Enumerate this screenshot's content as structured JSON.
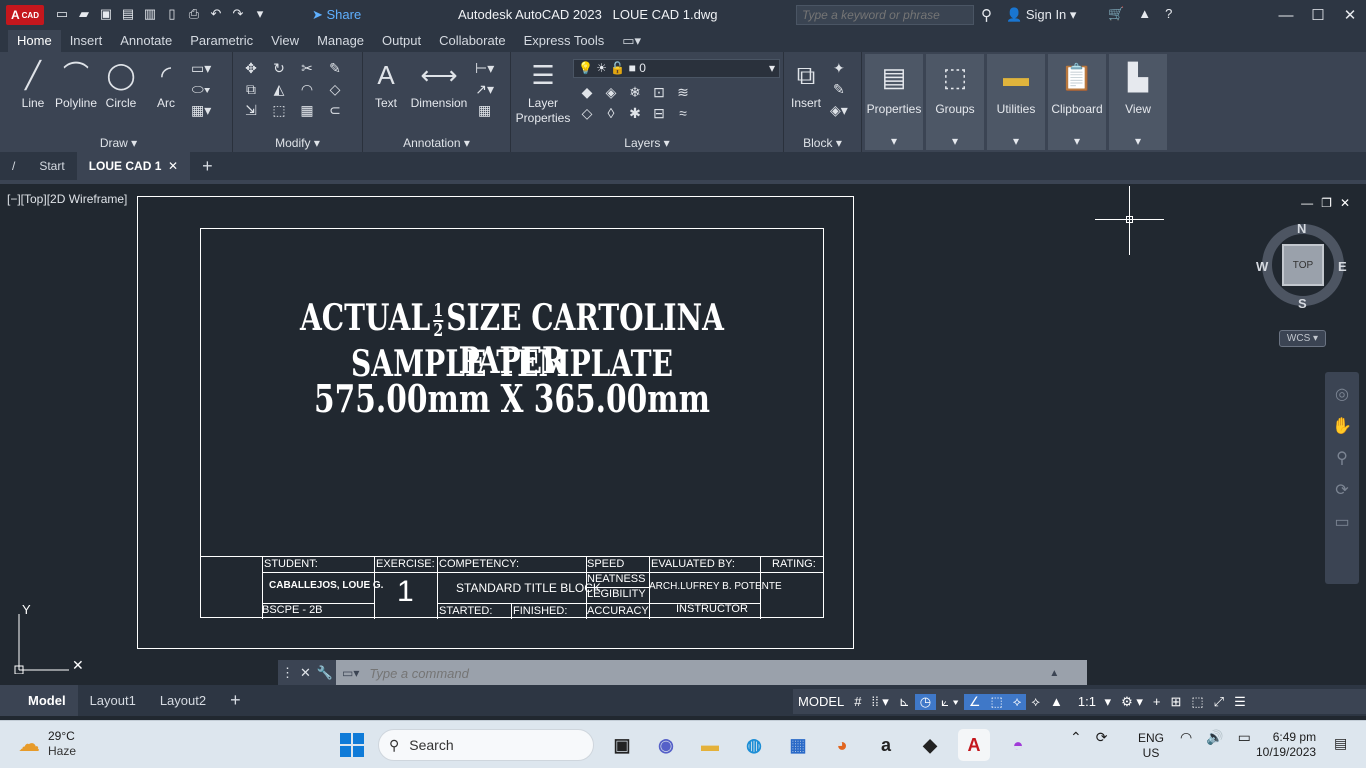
{
  "titlebar": {
    "logo": "A",
    "logo_sub": "CAD",
    "share": "Share",
    "title": "Autodesk AutoCAD 2023",
    "filename": "LOUE CAD 1.dwg",
    "search_placeholder": "Type a keyword or phrase",
    "sign_in": "Sign In"
  },
  "ribbon_tabs": [
    "Home",
    "Insert",
    "Annotate",
    "Parametric",
    "View",
    "Manage",
    "Output",
    "Collaborate",
    "Express Tools"
  ],
  "ribbon": {
    "draw": {
      "label": "Draw",
      "tools": [
        "Line",
        "Polyline",
        "Circle",
        "Arc"
      ]
    },
    "modify": {
      "label": "Modify"
    },
    "annotation": {
      "label": "Annotation",
      "tools": [
        "Text",
        "Dimension"
      ]
    },
    "layers": {
      "label": "Layers",
      "layer_props": "Layer Properties",
      "current_layer": "0"
    },
    "block": {
      "label": "Block",
      "insert": "Insert"
    },
    "properties": "Properties",
    "groups": "Groups",
    "utilities": "Utilities",
    "clipboard": "Clipboard",
    "view": "View"
  },
  "file_tabs": {
    "start": "Start",
    "current": "LOUE CAD 1"
  },
  "viewport": {
    "label": "[−][Top][2D Wireframe]",
    "compass": {
      "n": "N",
      "s": "S",
      "e": "E",
      "w": "W",
      "top": "TOP",
      "wcs": "WCS"
    }
  },
  "drawing": {
    "line1_a": "ACTUAL",
    "frac_num": "1",
    "frac_den": "2",
    "line1_b": "SIZE CARTOLINA PAPER",
    "line2": "SAMPLE TEMPLATE",
    "line3": "575.00mm X 365.00mm",
    "titleblock": {
      "student_label": "STUDENT:",
      "student_name": "CABALLEJOS, LOUE G.",
      "section": "BSCPE - 2B",
      "exercise_label": "EXERCISE:",
      "exercise_no": "1",
      "competency_label": "COMPETENCY:",
      "competency": "STANDARD TITLE BLOCK",
      "started": "STARTED:",
      "finished": "FINISHED:",
      "speed": "SPEED",
      "neatness": "NEATNESS",
      "legibility": "LEGIBILITY",
      "accuracy": "ACCURACY",
      "evaluated_label": "EVALUATED BY:",
      "evaluator": "ARCH.LUFREY B. POTENTE",
      "evaluator_role": "INSTRUCTOR",
      "rating_label": "RATING:"
    }
  },
  "command": {
    "placeholder": "Type a command"
  },
  "layout_tabs": [
    "Model",
    "Layout1",
    "Layout2"
  ],
  "status": {
    "model": "MODEL",
    "scale": "1:1"
  },
  "taskbar": {
    "temp": "29°C",
    "weather": "Haze",
    "search": "Search",
    "lang1": "ENG",
    "lang2": "US",
    "time": "6:49 pm",
    "date": "10/19/2023"
  }
}
